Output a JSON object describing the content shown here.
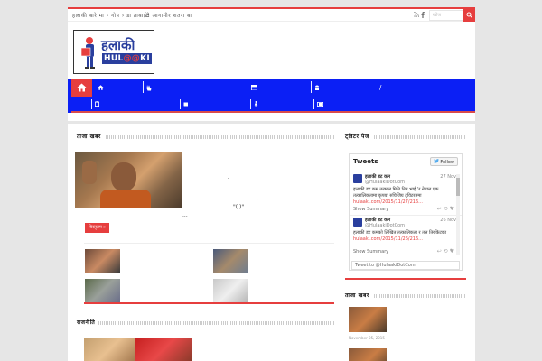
{
  "topbar": {
    "links": [
      "हलाकी बारे मा › गोप › डा ताबाईट",
      "टी आगामीर शतरा बा"
    ],
    "search_placeholder": "खोज"
  },
  "logo": {
    "title": "हलाकी",
    "subtitle_pre": "HUL",
    "subtitle_at": "@@",
    "subtitle_post": "KI"
  },
  "nav": {
    "row1_separators": 4,
    "row2_separators": 4
  },
  "left": {
    "section1_title": "ताजा खबर",
    "feature_lines": [
      "-",
      ",",
      "\"(       )\""
    ],
    "feature_ellipsis": "...",
    "more_label": "विस्तृतम »",
    "section2_title": "राजनीति"
  },
  "right": {
    "section1_title": "ट्विटर पेज",
    "tweets_title": "Tweets",
    "follow_label": "Follow",
    "tweets": [
      {
        "name": "हलाकी डट कम",
        "handle": "@HulaakiDotCom",
        "date": "27 Nov",
        "body": "हलाकी डट कम तत्काल मिति तिन भाई 'र नेपाल एक तत्कालिकतामा कृपया रुचिजिय ट्विटरतमा",
        "link": "hulaaki.com/2015/11/27/216...",
        "summary": "Show Summary"
      },
      {
        "name": "हलाकी डट कम",
        "handle": "@HulaakiDotCom",
        "date": "26 Nov",
        "body": "हलाकी डट कमको लिखित तत्कालिकता र तत्त तिरकिंटका",
        "link": "hulaaki.com/2015/11/26/216...",
        "summary": "Show Summary"
      }
    ],
    "tweet_to": "Tweet to @HulaakiDotCom",
    "section2_title": "ताजा खबर",
    "news": [
      {
        "date": "November 25, 2015"
      }
    ]
  }
}
